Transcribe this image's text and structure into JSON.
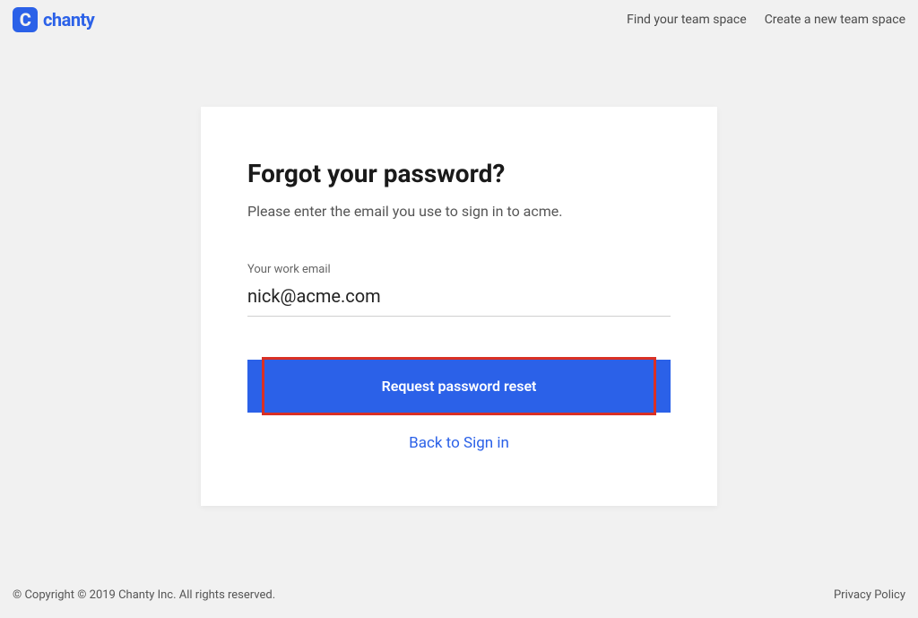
{
  "header": {
    "logo_text": "chanty",
    "link_find": "Find your team space",
    "link_create": "Create a new team space"
  },
  "card": {
    "title": "Forgot your password?",
    "subtitle": "Please enter the email you use to sign in to acme.",
    "field_label": "Your work email",
    "email_value": "nick@acme.com",
    "button_label": "Request password reset",
    "back_link": "Back to Sign in"
  },
  "footer": {
    "copyright": "© Copyright © 2019 Chanty Inc. All rights reserved.",
    "privacy": "Privacy Policy"
  }
}
